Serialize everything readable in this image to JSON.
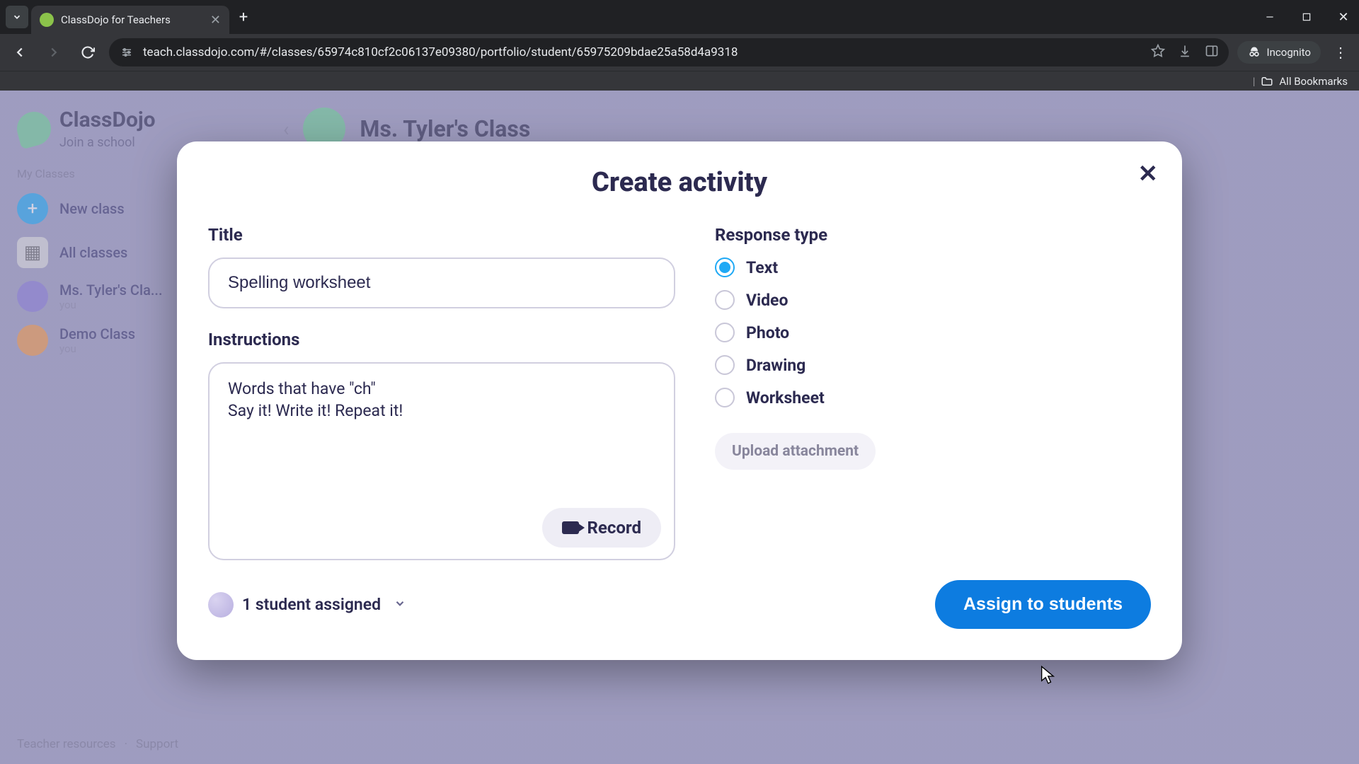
{
  "browser": {
    "tab_title": "ClassDojo for Teachers",
    "url": "teach.classdojo.com/#/classes/65974c810cf2c06137e09380/portfolio/student/65975209bdae25a58d4a9318",
    "incognito_label": "Incognito",
    "bookmarks_label": "All Bookmarks"
  },
  "page": {
    "brand": "ClassDojo",
    "join_school": "Join a school",
    "my_classes": "My Classes",
    "new_class": "New class",
    "all_classes": "All classes",
    "class_1": "Ms. Tyler's Cla...",
    "class_1_sub": "you",
    "class_2": "Demo Class",
    "class_2_sub": "you",
    "header_class": "Ms. Tyler's Class",
    "teacher_resources": "Teacher resources",
    "support": "Support",
    "dot": "·"
  },
  "modal": {
    "title": "Create activity",
    "title_label": "Title",
    "title_value": "Spelling worksheet",
    "instructions_label": "Instructions",
    "instructions_value": "Words that have \"ch\"\nSay it! Write it! Repeat it!",
    "record_label": "Record",
    "response_label": "Response type",
    "response_options": [
      {
        "label": "Text",
        "selected": true
      },
      {
        "label": "Video",
        "selected": false
      },
      {
        "label": "Photo",
        "selected": false
      },
      {
        "label": "Drawing",
        "selected": false
      },
      {
        "label": "Worksheet",
        "selected": false
      }
    ],
    "upload_label": "Upload attachment",
    "assigned_label": "1 student assigned",
    "assign_button": "Assign to students"
  }
}
